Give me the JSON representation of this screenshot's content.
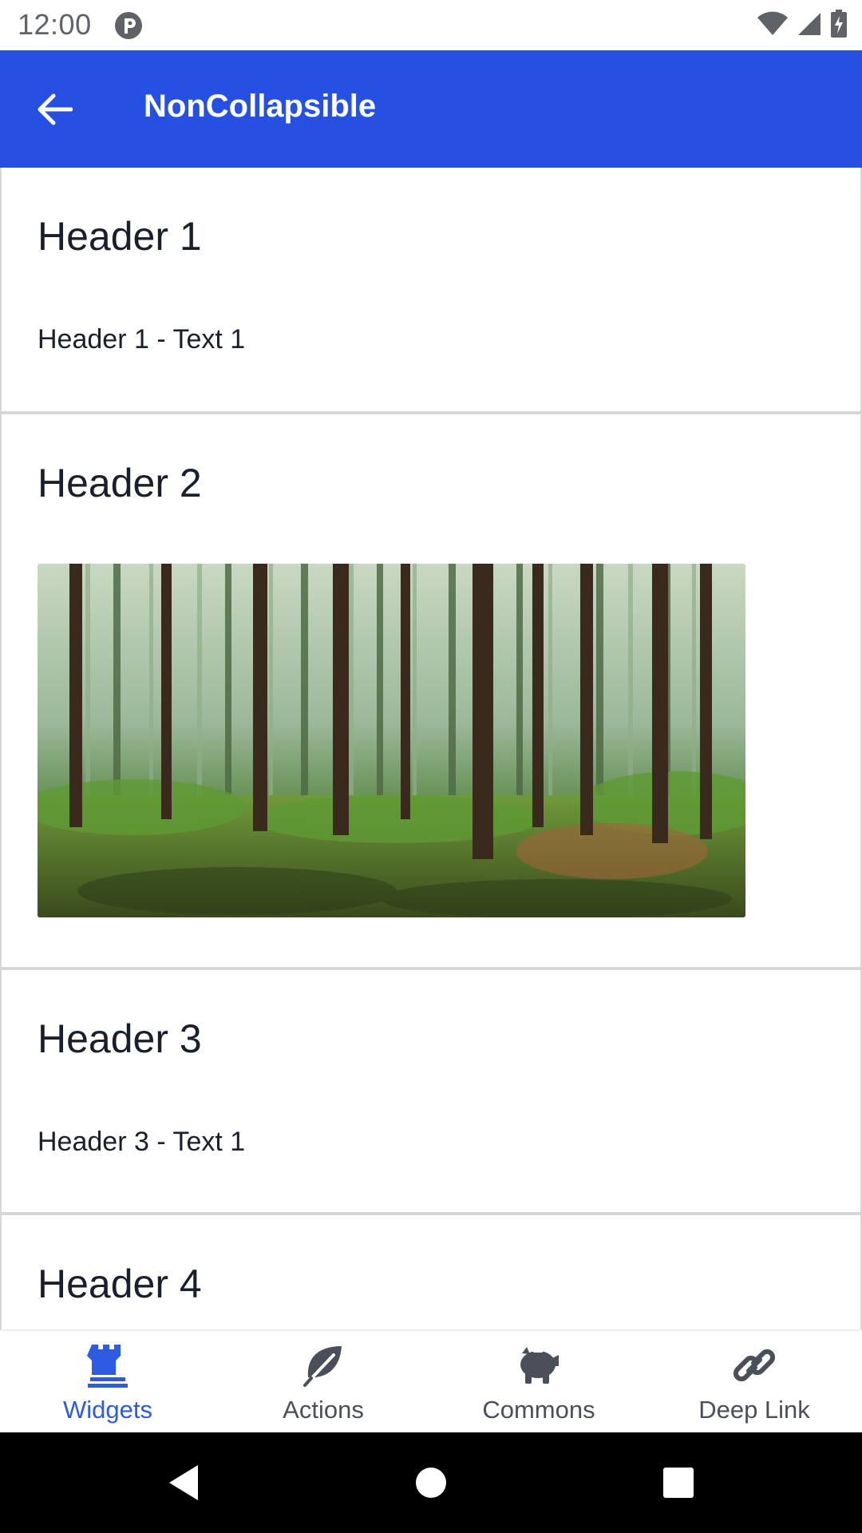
{
  "status_bar": {
    "time": "12:00"
  },
  "app_bar": {
    "title": "NonCollapsible",
    "back_icon": "arrow-back-icon",
    "color": "#2650e1"
  },
  "sections": [
    {
      "header": "Header 1",
      "text": "Header 1 - Text 1"
    },
    {
      "header": "Header 2",
      "image": "forest-image"
    },
    {
      "header": "Header 3",
      "text": "Header 3 - Text 1"
    },
    {
      "header": "Header 4"
    }
  ],
  "bottom_nav": {
    "items": [
      {
        "label": "Widgets",
        "icon": "castle-icon",
        "active": true
      },
      {
        "label": "Actions",
        "icon": "leaf-icon",
        "active": false
      },
      {
        "label": "Commons",
        "icon": "piggy-bank-icon",
        "active": false
      },
      {
        "label": "Deep Link",
        "icon": "link-icon",
        "active": false
      }
    ],
    "active_color": "#2d5be3"
  },
  "system_nav": {
    "buttons": [
      "back-triangle-icon",
      "home-circle-icon",
      "recents-square-icon"
    ]
  }
}
